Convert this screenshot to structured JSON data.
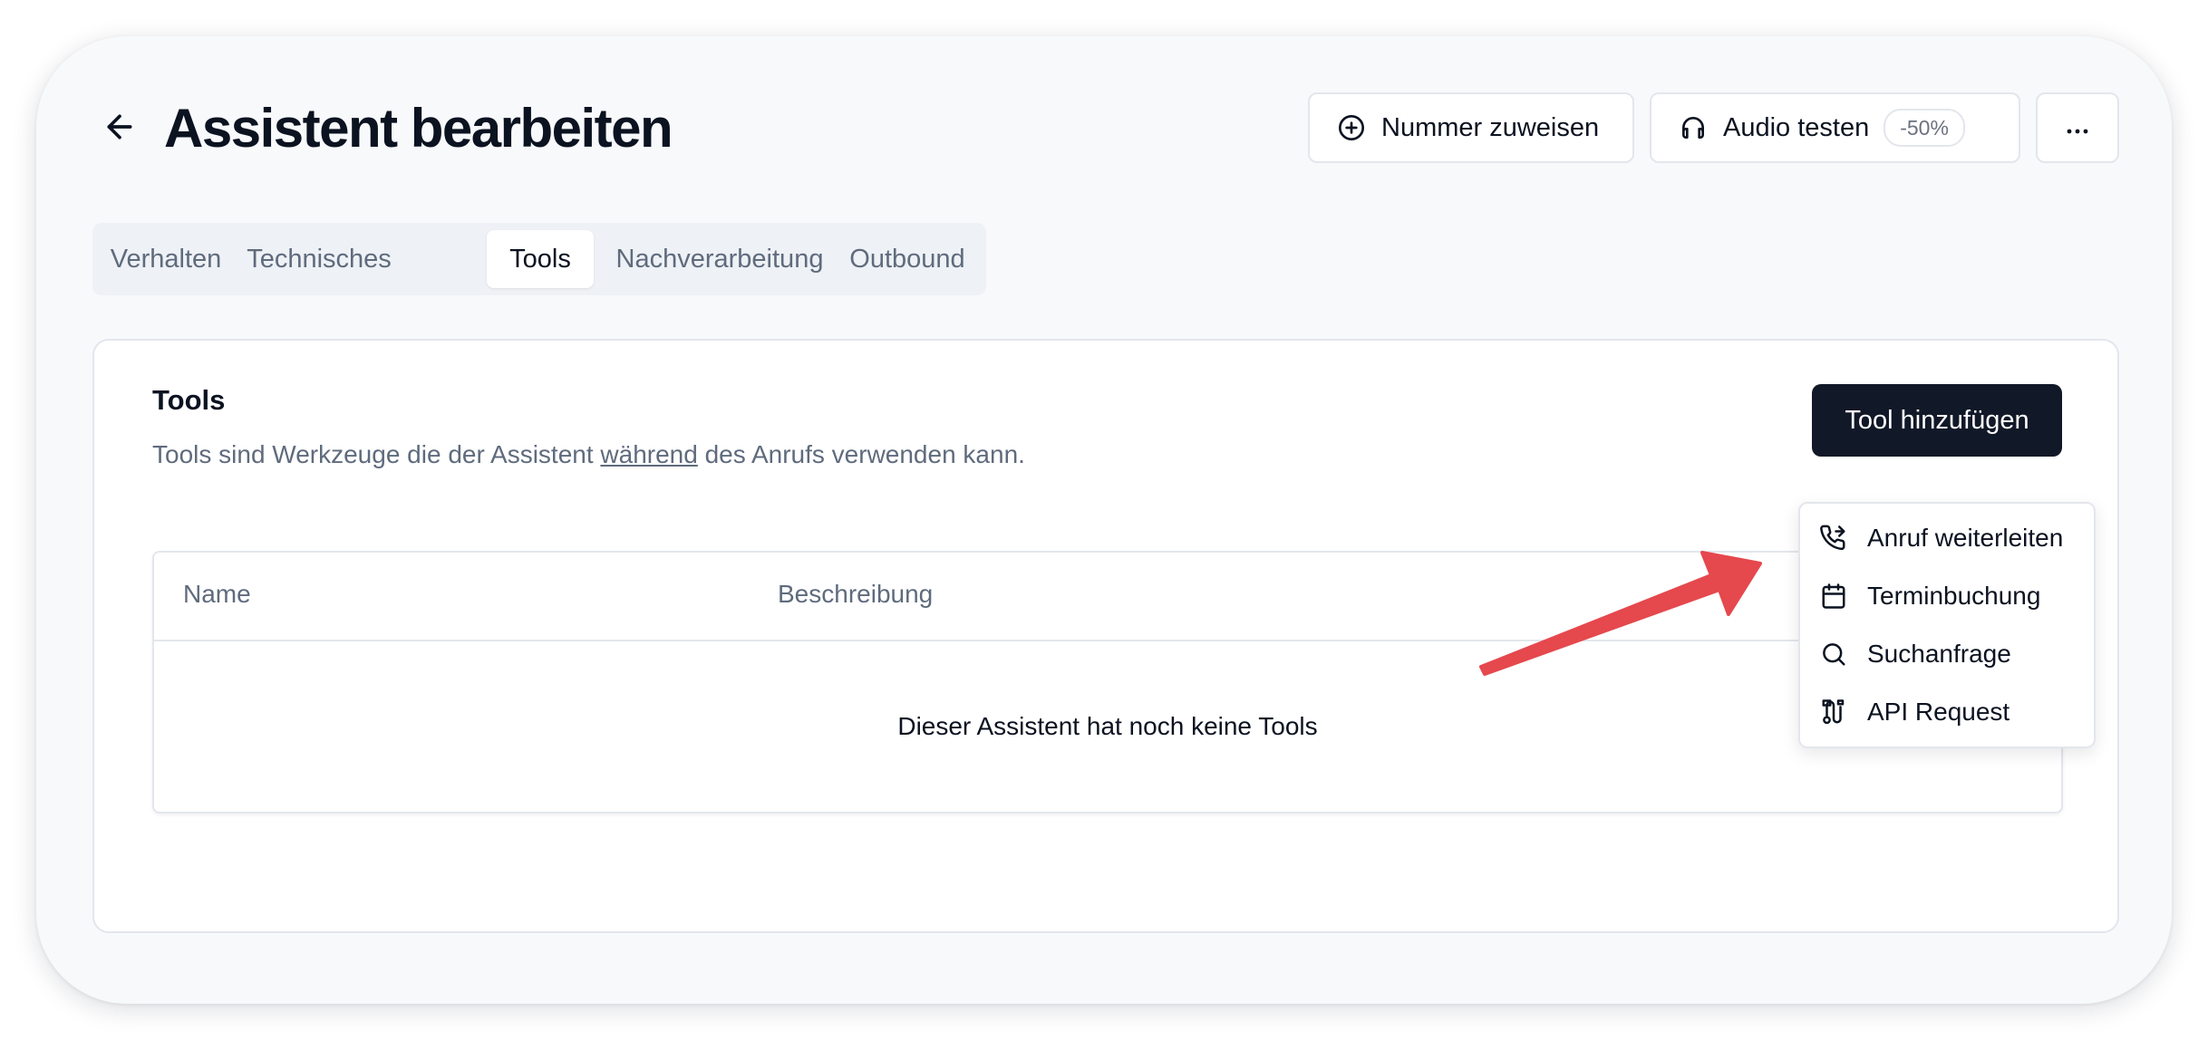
{
  "header": {
    "title": "Assistent bearbeiten",
    "assign_label": "Nummer zuweisen",
    "audio_label": "Audio testen",
    "audio_badge": "-50%",
    "more_label": "···"
  },
  "tabs": [
    {
      "label": "Verhalten",
      "active": false
    },
    {
      "label": "Technisches",
      "active": false
    },
    {
      "label": "Tools",
      "active": true
    },
    {
      "label": "Nachverarbeitung",
      "active": false
    },
    {
      "label": "Outbound",
      "active": false
    }
  ],
  "tools_card": {
    "title": "Tools",
    "description_before": "Tools sind Werkzeuge die der Assistent ",
    "description_underlined": "während",
    "description_after": " des Anrufs verwenden kann.",
    "add_button": "Tool hinzufügen",
    "table": {
      "columns": [
        "Name",
        "Beschreibung"
      ],
      "empty_message": "Dieser Assistent hat noch keine Tools"
    }
  },
  "dropdown": {
    "items": [
      {
        "label": "Anruf weiterleiten",
        "icon": "phone-forward-icon"
      },
      {
        "label": "Terminbuchung",
        "icon": "calendar-icon"
      },
      {
        "label": "Suchanfrage",
        "icon": "search-icon"
      },
      {
        "label": "API Request",
        "icon": "route-icon"
      }
    ]
  },
  "annotation": {
    "arrow_color": "#e5484d"
  },
  "colors": {
    "primary_button": "#111827",
    "muted_text": "#5f6b7d",
    "background": "#f8f9fb"
  }
}
